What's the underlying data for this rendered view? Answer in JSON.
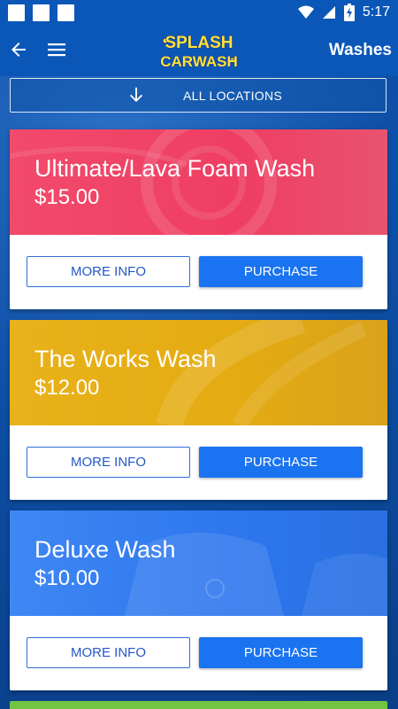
{
  "status_bar": {
    "time": "5:17",
    "icons": [
      "notification-square-icon",
      "notification-square-icon",
      "notification-square-icon",
      "wifi-icon",
      "signal-icon",
      "battery-charging-icon"
    ]
  },
  "app_bar": {
    "title": "Washes",
    "logo_line1": "SPLASH",
    "logo_line2": "CARWASH",
    "back_icon": "arrow-back-icon",
    "menu_icon": "hamburger-menu-icon"
  },
  "location_selector": {
    "label": "ALL LOCATIONS",
    "icon": "arrow-down-icon"
  },
  "washes": [
    {
      "name": "Ultimate/Lava Foam Wash",
      "price": "$15.00",
      "color": "#ef3e62",
      "info_label": "MORE INFO",
      "purchase_label": "PURCHASE"
    },
    {
      "name": "The Works Wash",
      "price": "$12.00",
      "color": "#e4ab12",
      "info_label": "MORE INFO",
      "purchase_label": "PURCHASE"
    },
    {
      "name": "Deluxe Wash",
      "price": "$10.00",
      "color": "#2d76ee",
      "info_label": "MORE INFO",
      "purchase_label": "PURCHASE"
    }
  ],
  "colors": {
    "app_bar": "#0b57b8",
    "primary_button": "#1a73f0",
    "secondary_border": "#2f6fd6",
    "next_card": "#74c444"
  }
}
